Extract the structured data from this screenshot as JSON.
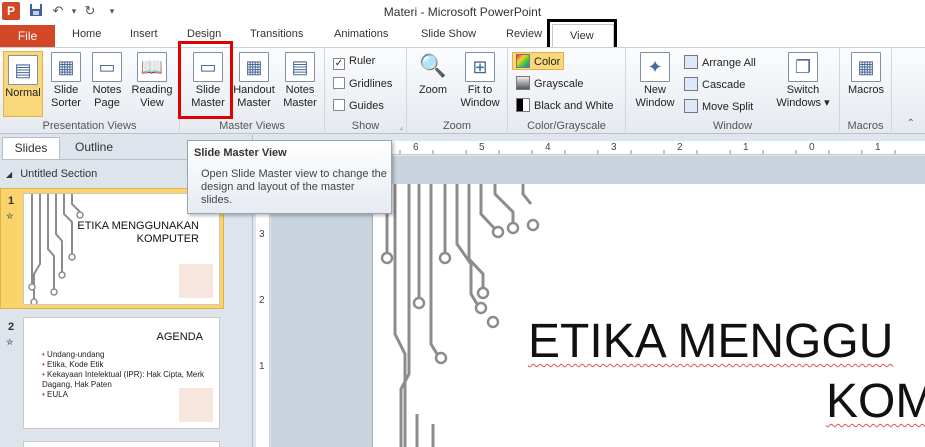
{
  "window": {
    "title": "Materi  -  Microsoft PowerPoint",
    "app_icon": "P"
  },
  "ribbon_tabs": [
    "File",
    "Home",
    "Insert",
    "Design",
    "Transitions",
    "Animations",
    "Slide Show",
    "Review",
    "View"
  ],
  "ribbon": {
    "presentation_views": {
      "label": "Presentation Views",
      "normal": [
        "Normal"
      ],
      "slide_sorter": [
        "Slide",
        "Sorter"
      ],
      "notes_page": [
        "Notes",
        "Page"
      ],
      "reading_view": [
        "Reading",
        "View"
      ]
    },
    "master_views": {
      "label": "Master Views",
      "slide_master": [
        "Slide",
        "Master"
      ],
      "handout_master": [
        "Handout",
        "Master"
      ],
      "notes_master": [
        "Notes",
        "Master"
      ]
    },
    "show": {
      "label": "Show",
      "ruler": "Ruler",
      "gridlines": "Gridlines",
      "guides": "Guides"
    },
    "zoom": {
      "label": "Zoom",
      "zoom": [
        "Zoom"
      ],
      "fit": [
        "Fit to",
        "Window"
      ]
    },
    "color": {
      "label": "Color/Grayscale",
      "color": "Color",
      "grayscale": "Grayscale",
      "bw": "Black and White"
    },
    "window": {
      "label": "Window",
      "new_window": [
        "New",
        "Window"
      ],
      "arrange_all": "Arrange All",
      "cascade": "Cascade",
      "move_split": "Move Split",
      "switch_windows": [
        "Switch",
        "Windows ▾"
      ]
    },
    "macros": {
      "label": "Macros",
      "macros": [
        "Macros"
      ]
    }
  },
  "tooltip": {
    "title": "Slide Master View",
    "body": "Open Slide Master view to change the design and layout of the master slides."
  },
  "left_pane": {
    "tabs": [
      "Slides",
      "Outline"
    ],
    "section": "Untitled Section",
    "slides": [
      {
        "num": "1",
        "title": "ETIKA MENGGUNAKAN KOMPUTER"
      },
      {
        "num": "2",
        "title": "AGENDA",
        "bullets": [
          "Undang-undang",
          "Etika, Kode Etik",
          "Kekayaan Intelektual (IPR): Hak Cipta, Merk Dagang, Hak Paten",
          "EULA"
        ]
      }
    ]
  },
  "rulers": {
    "horizontal": [
      "6",
      "5",
      "4",
      "3",
      "2",
      "1",
      "0",
      "1"
    ],
    "vertical": [
      "3",
      "2",
      "1"
    ]
  },
  "slide": {
    "title_line1": "ETIKA MENGGU",
    "title_line2": "KOM"
  },
  "colors": {
    "file_tab": "#d24726",
    "highlight_red": "#e00000",
    "circuit": "#8c8c8c",
    "selected_thumb": "#f7d36a"
  }
}
